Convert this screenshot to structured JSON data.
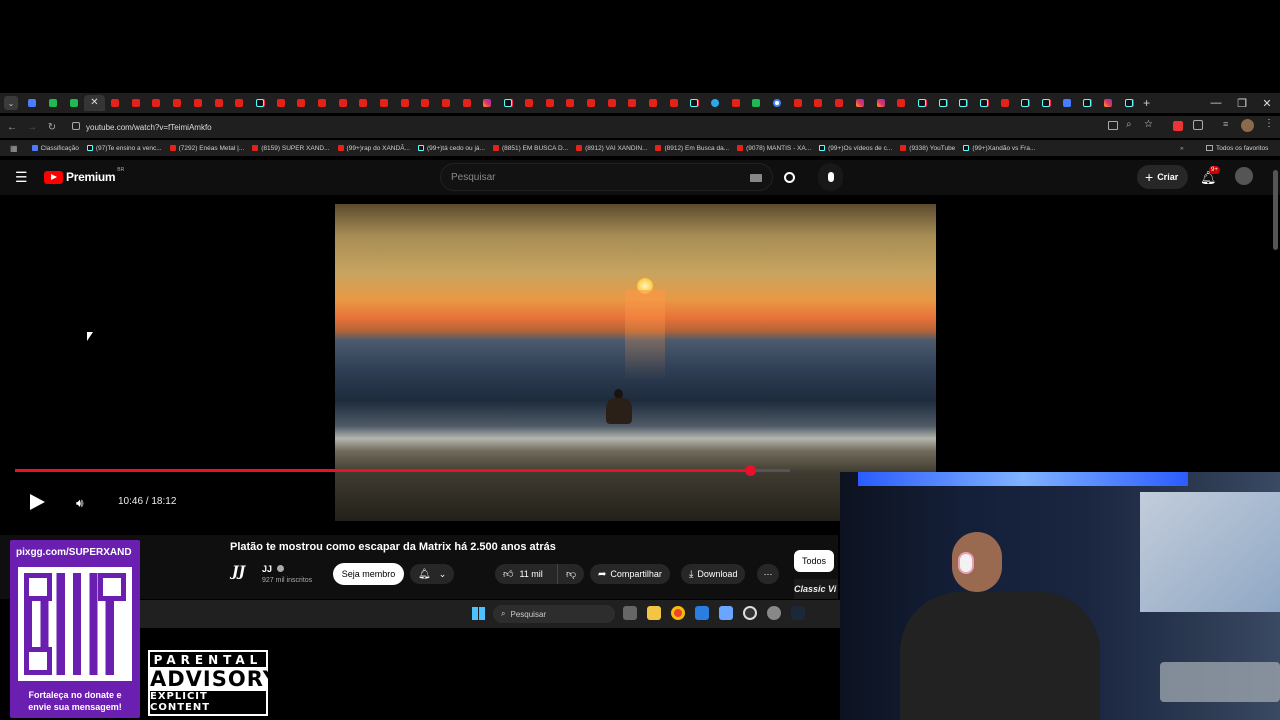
{
  "browser": {
    "url": "youtube.com/watch?v=fTeimiAmkfo",
    "tab_favicons": [
      "yt",
      "yt",
      "yt",
      "yt",
      "yt",
      "yt",
      "yt",
      "tt",
      "yt",
      "yt",
      "yt",
      "yt",
      "yt",
      "yt",
      "yt",
      "yt",
      "yt",
      "yt",
      "ig",
      "tt",
      "yt",
      "yt",
      "yt",
      "yt",
      "yt",
      "yt",
      "yt",
      "yt",
      "tt",
      "tg",
      "yt",
      "gr",
      "gg",
      "yt",
      "yt",
      "yt",
      "ig",
      "ig",
      "yt",
      "tt",
      "tt",
      "tt",
      "tt",
      "yt",
      "tt",
      "tt",
      "bl",
      "tt",
      "ig",
      "tt"
    ],
    "new_tab_label": "+",
    "bookmarks": [
      {
        "label": "Classificação",
        "icon": "bl"
      },
      {
        "label": "(97)Te ensino a venc...",
        "icon": "tt"
      },
      {
        "label": "(7292) Enéas Metal |...",
        "icon": "yt"
      },
      {
        "label": "(8159) SUPER XAND...",
        "icon": "yt"
      },
      {
        "label": "(99+)rap do XANDÃ...",
        "icon": "yt"
      },
      {
        "label": "(99+)tá cedo ou já...",
        "icon": "tt"
      },
      {
        "label": "(8851) EM BUSCA D...",
        "icon": "yt"
      },
      {
        "label": "(8912) VAI XANDIN...",
        "icon": "yt"
      },
      {
        "label": "(8912) Em Busca da...",
        "icon": "yt"
      },
      {
        "label": "(9078) MANTIS - XA...",
        "icon": "yt"
      },
      {
        "label": "(99+)Os vídeos de c...",
        "icon": "tt"
      },
      {
        "label": "(9338) YouTube",
        "icon": "yt"
      },
      {
        "label": "(99+)Xandão vs Fra...",
        "icon": "tt"
      }
    ],
    "all_bookmarks": "Todos os favoritos"
  },
  "youtube": {
    "logo": "Premium",
    "region": "BR",
    "search_placeholder": "Pesquisar",
    "create_label": "Criar",
    "notif_count": "9+"
  },
  "player": {
    "time": "10:46 / 18:12",
    "progress": 0.948,
    "played_color": "#e8102b"
  },
  "video": {
    "title": "Platão te mostrou como escapar da Matrix há 2.500 anos atrás",
    "channel": "JJ",
    "channel_logo": "JJ",
    "subscribers": "927 mil inscritos",
    "member_label": "Seja membro",
    "likes": "11 mil",
    "share_label": "Compartilhar",
    "download_label": "Download",
    "chip_all": "Todos",
    "side_thumb": "Classic Vi"
  },
  "taskbar": {
    "search_placeholder": "Pesquisar"
  },
  "overlay": {
    "qr_url": "pixgg.com/SUPERXAND",
    "qr_caption": "Fortaleça no donate e envie sua mensagem!",
    "advisory_top": "PARENTAL",
    "advisory_mid": "ADVISORY",
    "advisory_bottom": "EXPLICIT CONTENT"
  }
}
